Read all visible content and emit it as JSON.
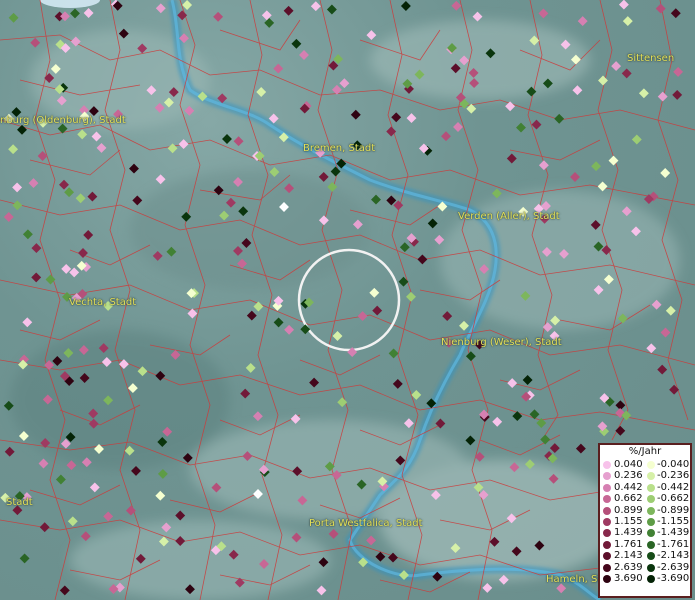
{
  "map": {
    "cities": [
      {
        "key": "oldenburg",
        "name": "nburg (Oldenburg), Stadt"
      },
      {
        "key": "bremen",
        "name": "Bremen, Stadt"
      },
      {
        "key": "sittensen",
        "name": "Sittensen"
      },
      {
        "key": "verden",
        "name": "Verden (Aller), Stadt"
      },
      {
        "key": "vechta",
        "name": "Vechta, Stadt"
      },
      {
        "key": "nienburg",
        "name": "Nienburg (Weser), Stadt"
      },
      {
        "key": "left_stadt",
        "name": "Stadt"
      },
      {
        "key": "porta",
        "name": "Porta Westfalica, Stadt"
      },
      {
        "key": "hameln",
        "name": "Hameln, St"
      }
    ],
    "colors": {
      "border": "#cc3b3b",
      "river": "#2f93c4",
      "legend_border": "#5a1f1f",
      "positive_scale": [
        "#f7c2ea",
        "#e6a0cf",
        "#d680b2",
        "#c76795",
        "#b5507a",
        "#9f3a62",
        "#88284b",
        "#721a39",
        "#5c0f2a",
        "#45071c",
        "#2e0311",
        "#1b0108"
      ],
      "negative_scale": [
        "#f5ffd0",
        "#d6f0a8",
        "#b9e08b",
        "#9dcd73",
        "#7db65c",
        "#5e9c46",
        "#418134",
        "#2a6525",
        "#174c18",
        "#0a350d",
        "#042306",
        "#011203"
      ]
    }
  },
  "legend": {
    "title": "%/Jahr",
    "positive": [
      "0.040",
      "0.236",
      "0.442",
      "0.662",
      "0.899",
      "1.155",
      "1.439",
      "1.761",
      "2.143",
      "2.639",
      "3.690"
    ],
    "negative": [
      "-0.040",
      "-0.236",
      "-0.442",
      "-0.662",
      "-0.899",
      "-1.155",
      "-1.439",
      "-1.761",
      "-2.143",
      "-2.639",
      "-3.690"
    ]
  }
}
